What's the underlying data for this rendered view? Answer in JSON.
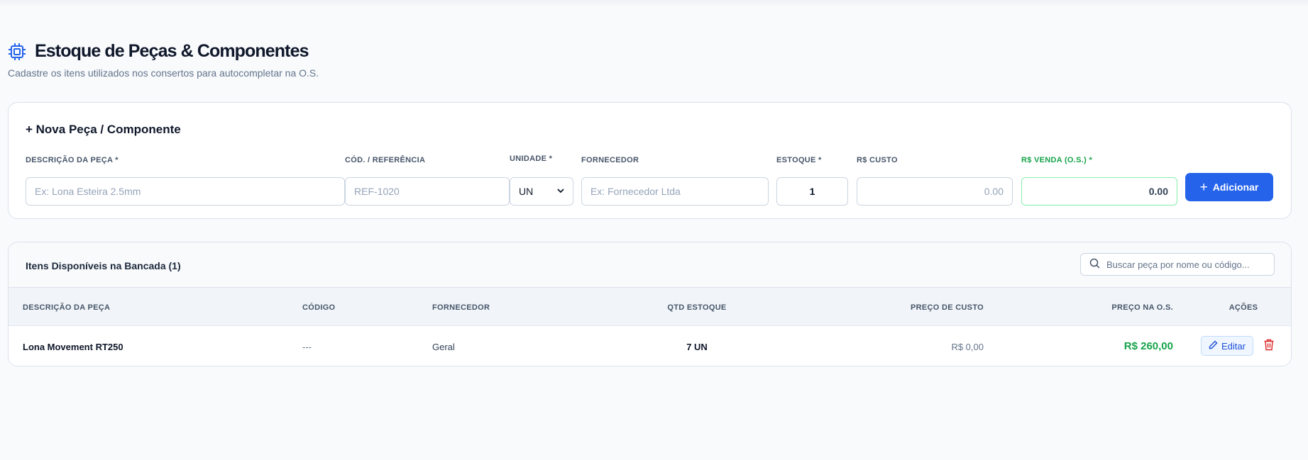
{
  "header": {
    "title": "Estoque de Peças & Componentes",
    "subtitle": "Cadastre os itens utilizados nos consertos para autocompletar na O.S.",
    "icon": "cpu-chip-icon",
    "accent": "#2563eb"
  },
  "form": {
    "title": "+ Nova Peça / Componente",
    "fields": {
      "descricao": {
        "label": "DESCRIÇÃO DA PEÇA *",
        "placeholder": "Ex: Lona Esteira 2.5mm",
        "value": ""
      },
      "codigo": {
        "label": "CÓD. / REFERÊNCIA",
        "placeholder": "REF-1020",
        "value": ""
      },
      "unidade": {
        "label": "UNIDADE *",
        "value": "UN"
      },
      "fornecedor": {
        "label": "FORNECEDOR",
        "placeholder": "Ex: Fornecedor Ltda",
        "value": ""
      },
      "estoque": {
        "label": "ESTOQUE *",
        "value": "1"
      },
      "custo": {
        "label": "R$ CUSTO",
        "placeholder": "0.00"
      },
      "venda": {
        "label": "R$ VENDA (O.S.) *",
        "value": "0.00"
      }
    },
    "add_button": "Adicionar"
  },
  "table": {
    "title": "Itens Disponíveis na Bancada (1)",
    "search_placeholder": "Buscar peça por nome ou código...",
    "columns": [
      "DESCRIÇÃO DA PEÇA",
      "CÓDIGO",
      "FORNECEDOR",
      "QTD ESTOQUE",
      "PREÇO DE CUSTO",
      "PREÇO NA O.S.",
      "AÇÕES"
    ],
    "rows": [
      {
        "descricao": "Lona Movement RT250",
        "codigo": "---",
        "fornecedor": "Geral",
        "qtd": "7 UN",
        "custo": "R$ 0,00",
        "preco_os": "R$ 260,00",
        "edit_label": "Editar"
      }
    ]
  },
  "colors": {
    "primary": "#2563eb",
    "success": "#16a34a",
    "danger": "#dc2626"
  }
}
